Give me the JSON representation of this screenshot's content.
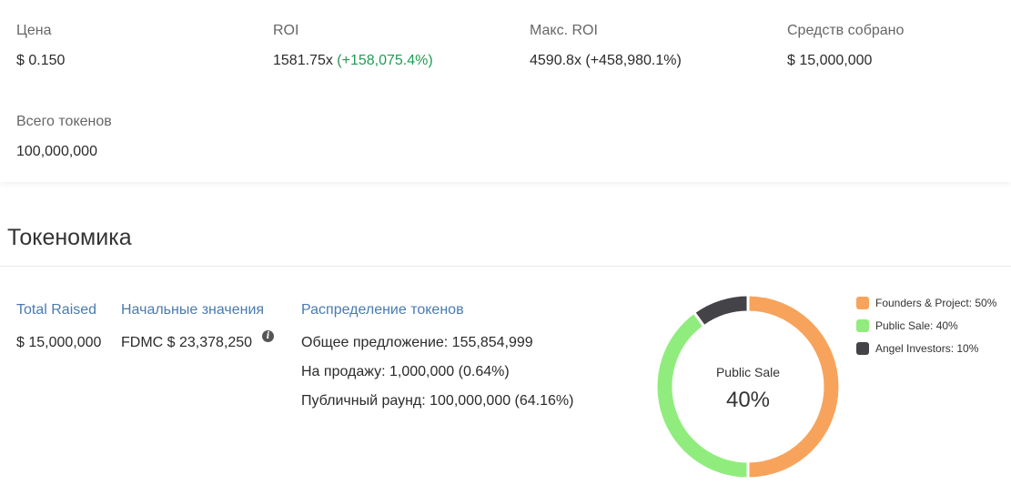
{
  "stats": {
    "price": {
      "label": "Цена",
      "value": "$ 0.150"
    },
    "roi": {
      "label": "ROI",
      "value": "1581.75x",
      "change": "(+158,075.4%)"
    },
    "max_roi": {
      "label": "Макс. ROI",
      "value": "4590.8x (+458,980.1%)"
    },
    "raised": {
      "label": "Средств собрано",
      "value": "$ 15,000,000"
    },
    "total_tokens": {
      "label": "Всего токенов",
      "value": "100,000,000"
    }
  },
  "tokenomics": {
    "title": "Токеномика",
    "total_raised": {
      "head": "Total Raised",
      "value": "$ 15,000,000"
    },
    "initial": {
      "head": "Начальные значения",
      "value": "FDMC $ 23,378,250",
      "info_icon": "info-icon"
    },
    "distribution": {
      "head": "Распределение токенов",
      "lines": [
        "Общее предложение:  155,854,999",
        "На продажу:  1,000,000 (0.64%)",
        "Публичный раунд:  100,000,000 (64.16%)"
      ]
    }
  },
  "chart_data": {
    "type": "pie",
    "donut": true,
    "center_label": "Public Sale",
    "center_value": "40%",
    "slices": [
      {
        "name": "Founders & Project",
        "value": 50,
        "color": "#f7a35c",
        "legend": "Founders & Project: 50%"
      },
      {
        "name": "Public Sale",
        "value": 40,
        "color": "#90ed7d",
        "legend": "Public Sale: 40%"
      },
      {
        "name": "Angel Investors",
        "value": 10,
        "color": "#434348",
        "legend": "Angel Investors: 10%"
      }
    ],
    "legend_position": "top-right"
  }
}
